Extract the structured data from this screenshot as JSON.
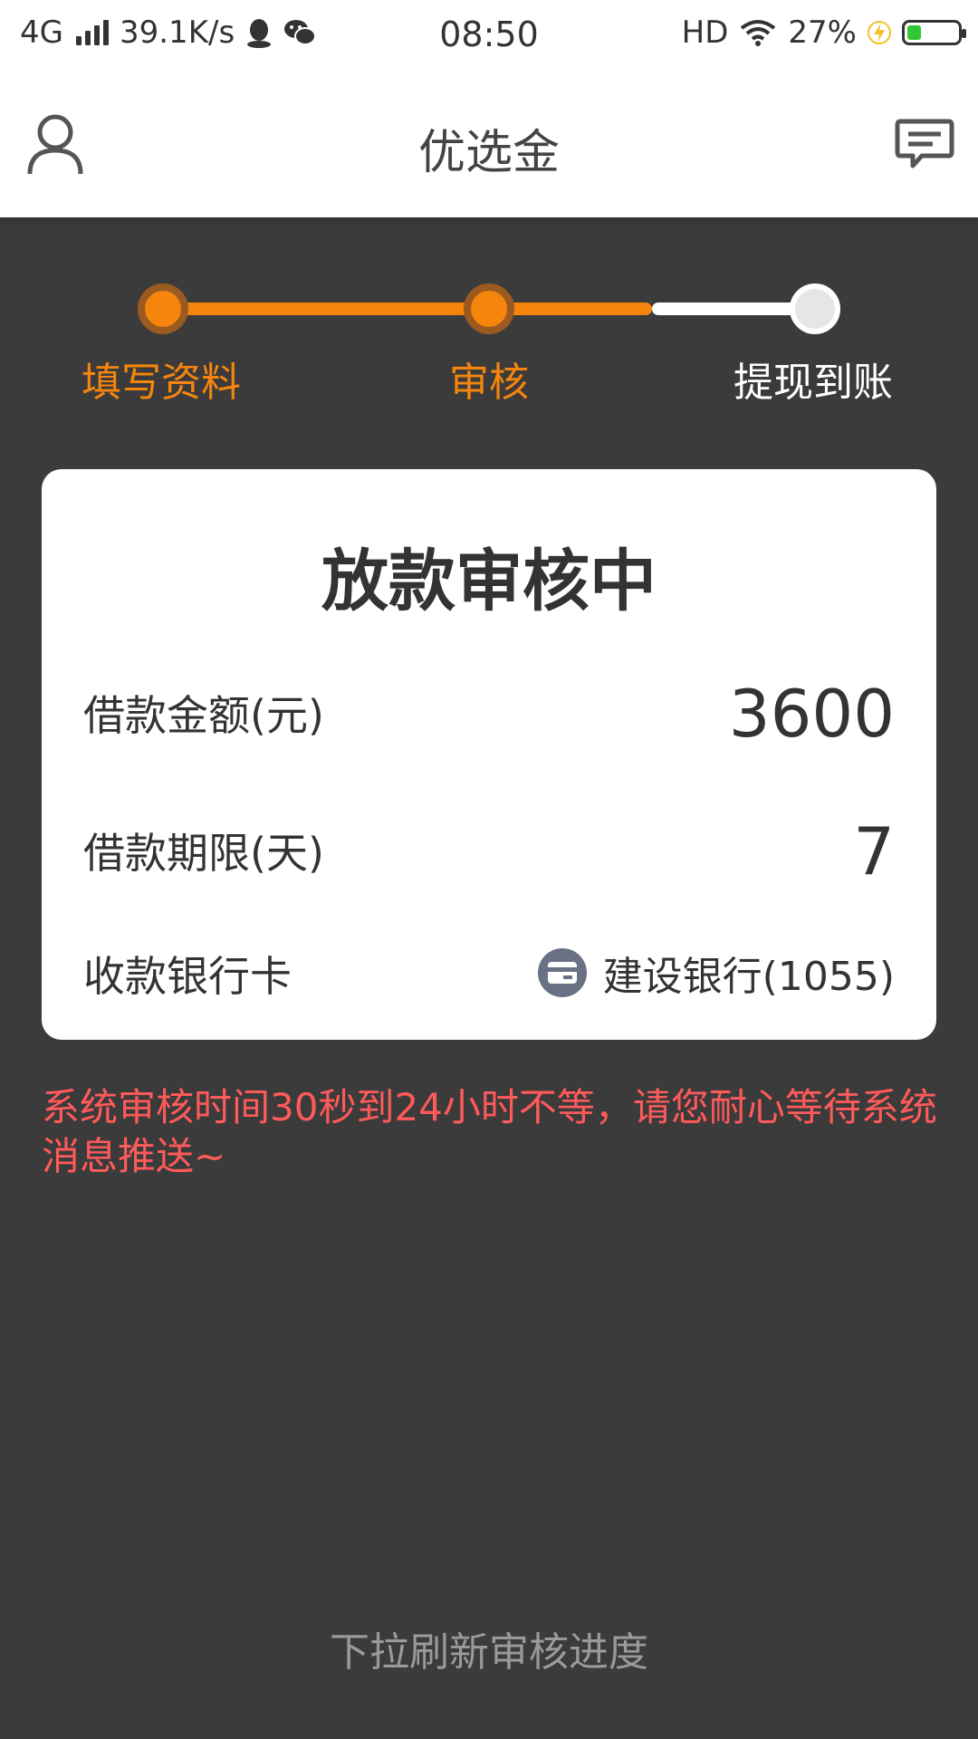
{
  "status_bar": {
    "network": "4G",
    "speed": "39.1K/s",
    "time": "08:50",
    "hd": "HD",
    "battery_pct": "27%",
    "battery_level": 0.27
  },
  "header": {
    "title": "优选金"
  },
  "steps": [
    {
      "label": "填写资料",
      "state": "done"
    },
    {
      "label": "审核",
      "state": "current"
    },
    {
      "label": "提现到账",
      "state": "pending"
    }
  ],
  "card": {
    "title": "放款审核中",
    "amount_label": "借款金额(元)",
    "amount_value": "3600",
    "term_label": "借款期限(天)",
    "term_value": "7",
    "bank_label": "收款银行卡",
    "bank_value": "建设银行(1055)"
  },
  "notice": "系统审核时间30秒到24小时不等，请您耐心等待系统消息推送~",
  "footer_hint": "下拉刷新审核进度",
  "colors": {
    "accent": "#f5850d",
    "background": "#3b3b3b",
    "notice": "#ff5a5a"
  }
}
